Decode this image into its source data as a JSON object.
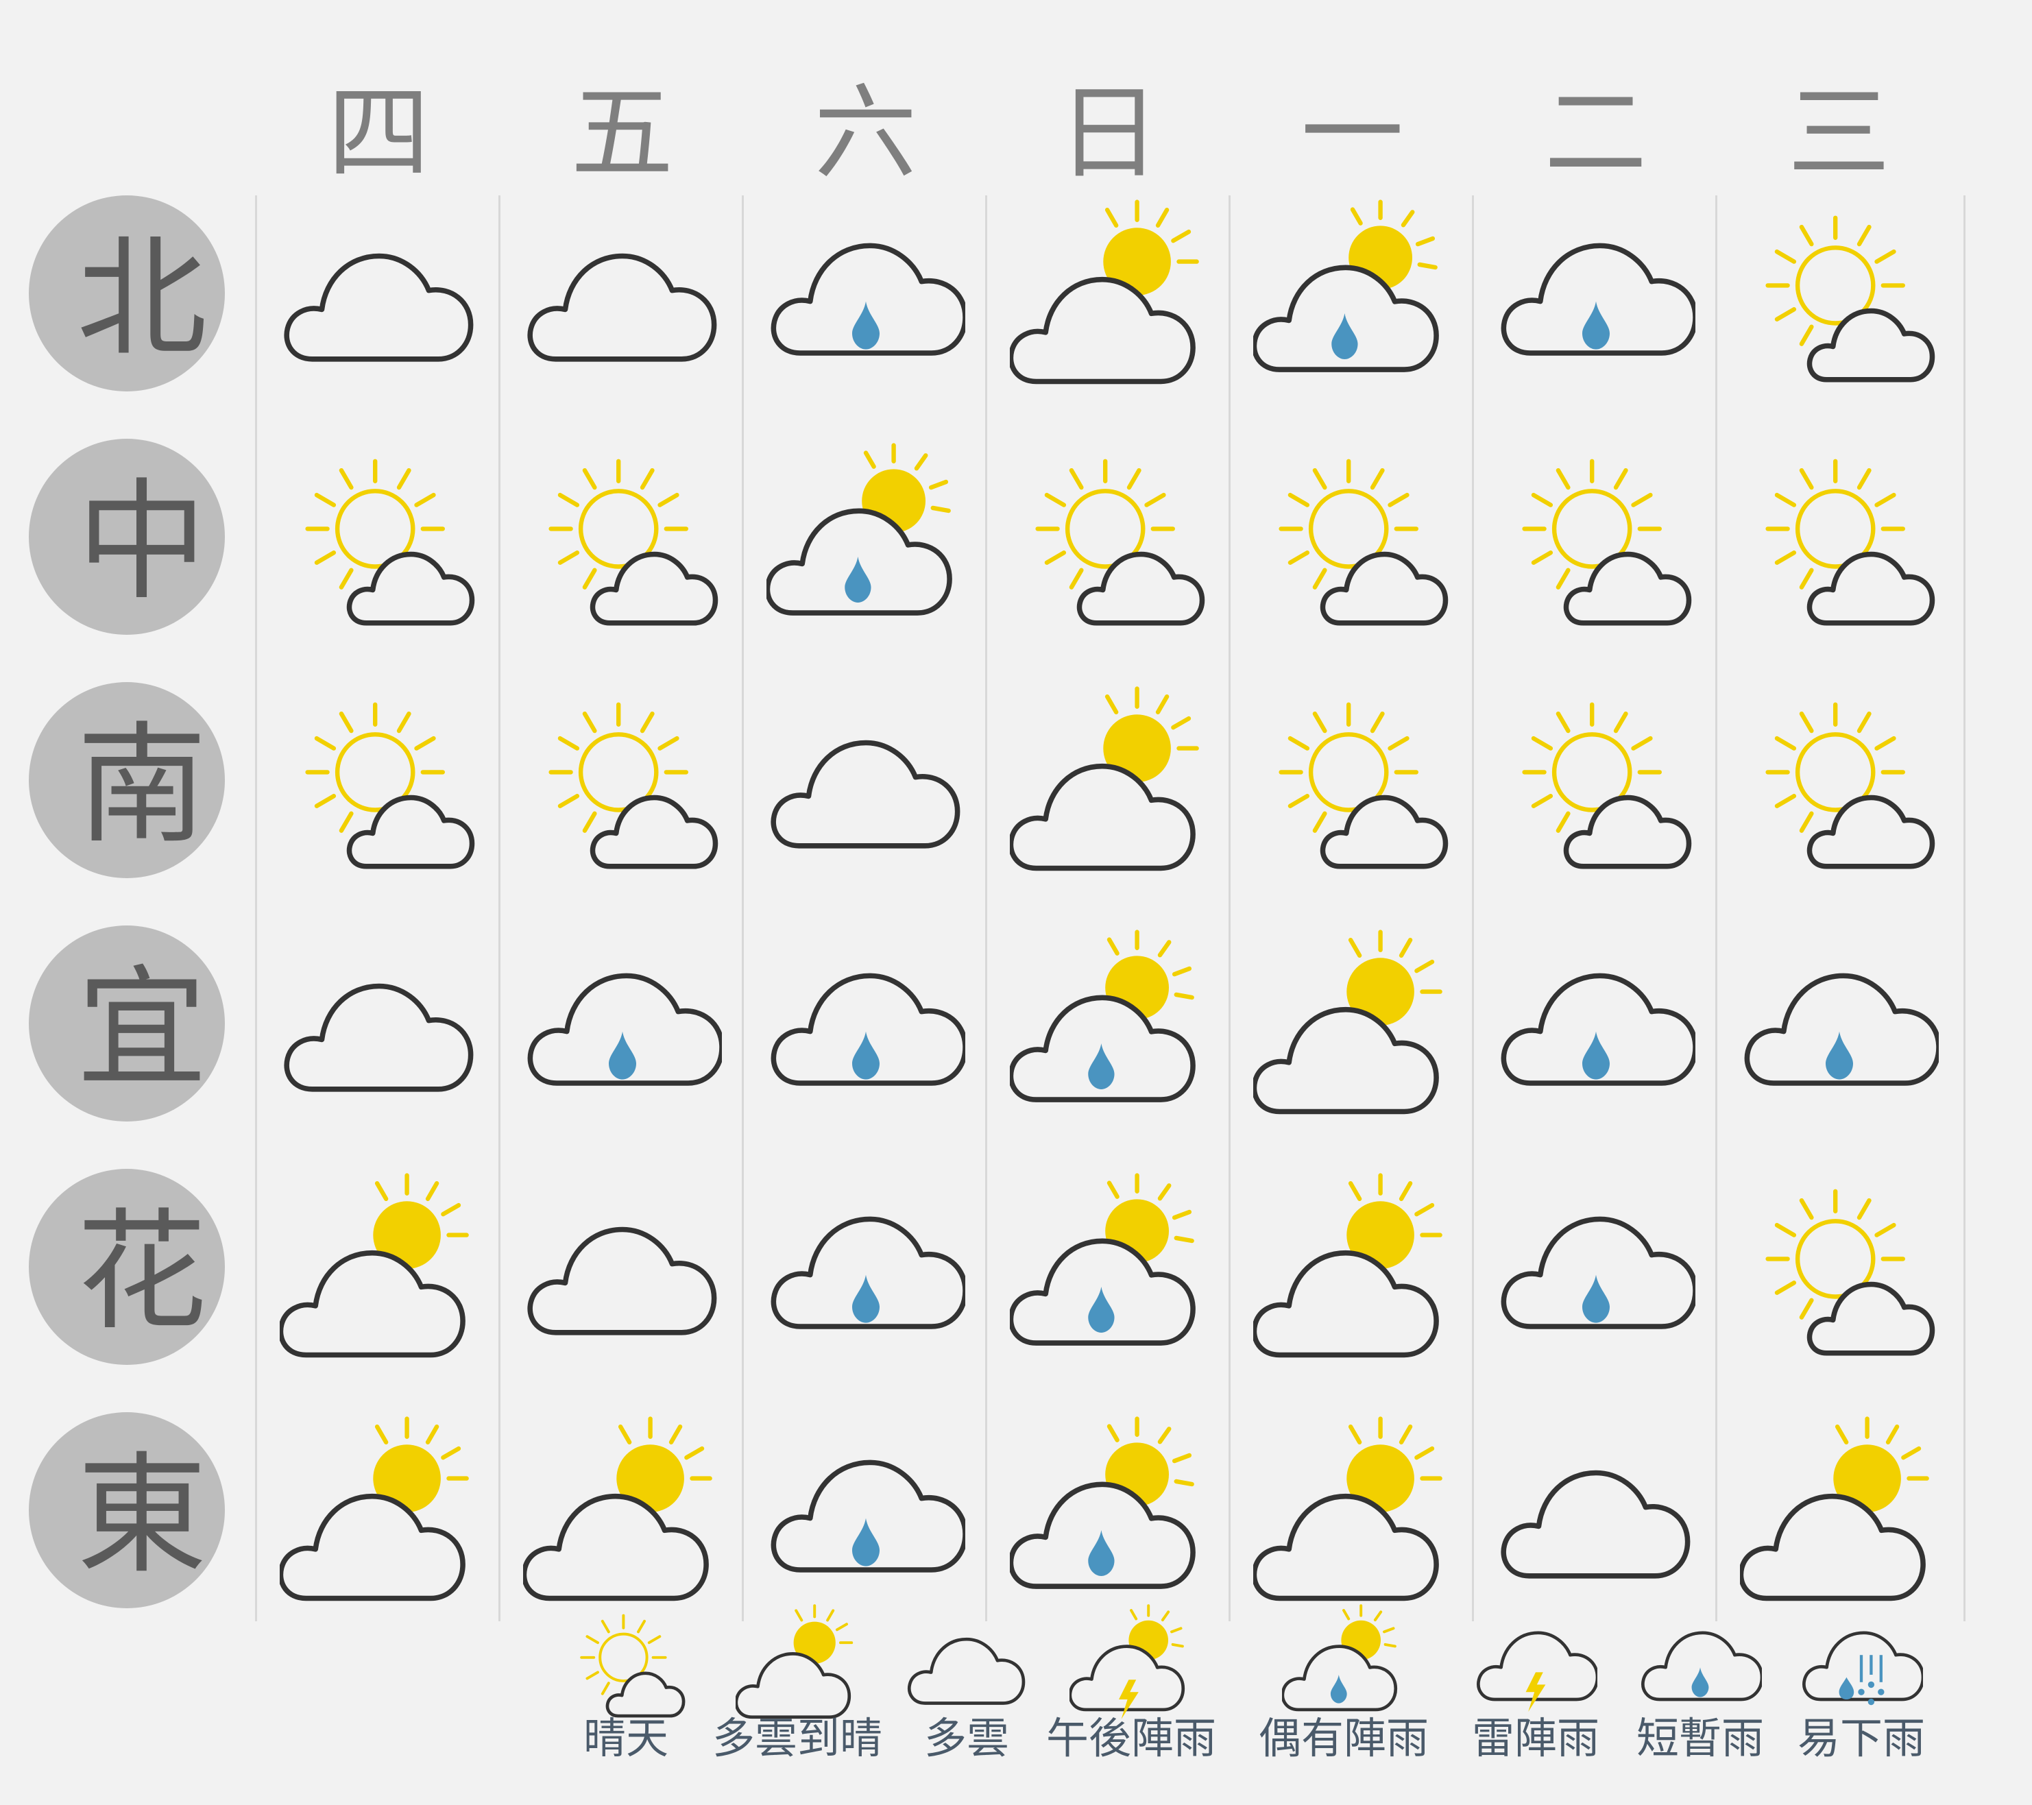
{
  "days": [
    "四",
    "五",
    "六",
    "日",
    "一",
    "二",
    "三"
  ],
  "regions": [
    {
      "name": "北",
      "weather": [
        "cloudy",
        "cloudy",
        "shower",
        "cloudy_sunny",
        "chance_shower",
        "shower",
        "sunny"
      ]
    },
    {
      "name": "中",
      "weather": [
        "sunny",
        "sunny",
        "chance_shower",
        "sunny",
        "sunny",
        "sunny",
        "sunny"
      ]
    },
    {
      "name": "南",
      "weather": [
        "sunny",
        "sunny",
        "cloudy",
        "cloudy_sunny",
        "sunny",
        "sunny",
        "sunny"
      ]
    },
    {
      "name": "宜",
      "weather": [
        "cloudy",
        "shower",
        "shower",
        "chance_shower",
        "cloudy_sunny",
        "shower",
        "shower"
      ]
    },
    {
      "name": "花",
      "weather": [
        "cloudy_sunny",
        "cloudy",
        "shower",
        "chance_shower",
        "cloudy_sunny",
        "shower",
        "sunny"
      ]
    },
    {
      "name": "東",
      "weather": [
        "cloudy_sunny",
        "cloudy_sunny",
        "shower",
        "chance_shower",
        "cloudy_sunny",
        "cloudy",
        "cloudy_sunny"
      ]
    }
  ],
  "legend": [
    {
      "type": "sunny",
      "label": "晴天"
    },
    {
      "type": "cloudy_sunny",
      "label": "多雲到晴"
    },
    {
      "type": "cloudy",
      "label": "多雲"
    },
    {
      "type": "afternoon_shower",
      "label": "午後陣雨"
    },
    {
      "type": "chance_shower",
      "label": "偶有陣雨"
    },
    {
      "type": "thunder_shower",
      "label": "雷陣雨"
    },
    {
      "type": "shower",
      "label": "短暫雨"
    },
    {
      "type": "rain",
      "label": "易下雨"
    }
  ],
  "colors": {
    "sun": "#f2d000",
    "rain": "#4a94c0",
    "outline": "#333333",
    "badge": "#bdbdbd",
    "header_text": "#7f7f7f",
    "legend_text": "#4a5a6a"
  }
}
